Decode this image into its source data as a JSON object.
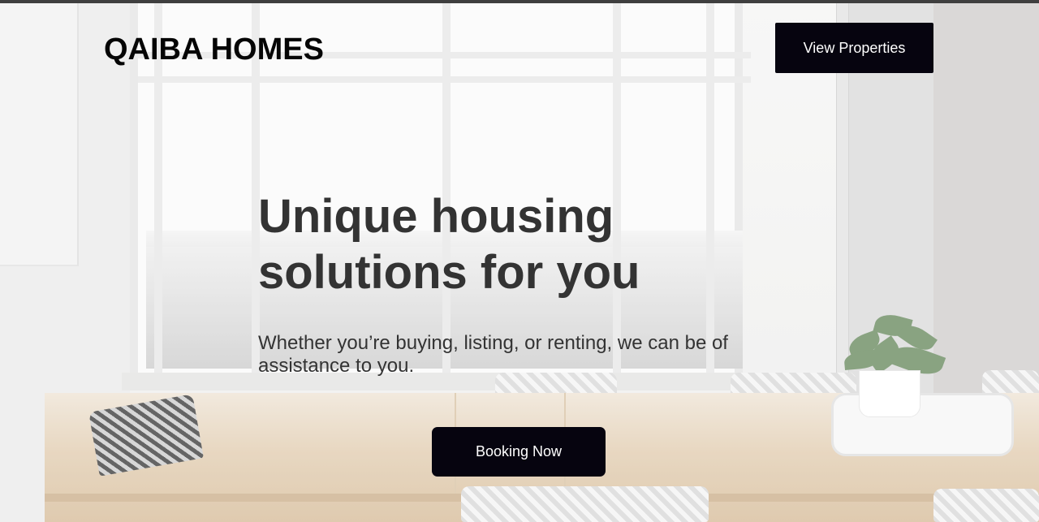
{
  "brand": {
    "name": "QAIBA HOMES"
  },
  "nav": {
    "view_properties_label": "View Properties"
  },
  "hero": {
    "headline": "Unique housing solutions for you",
    "subtext": "Whether you’re buying, listing, or renting, we can be of assistance to you.",
    "cta_label": "Booking Now",
    "background_image": "bright-dining-room-with-window-photo"
  },
  "colors": {
    "button_bg": "#06040f",
    "button_text": "#ffffff",
    "headline": "#333333",
    "brand": "#050505"
  }
}
